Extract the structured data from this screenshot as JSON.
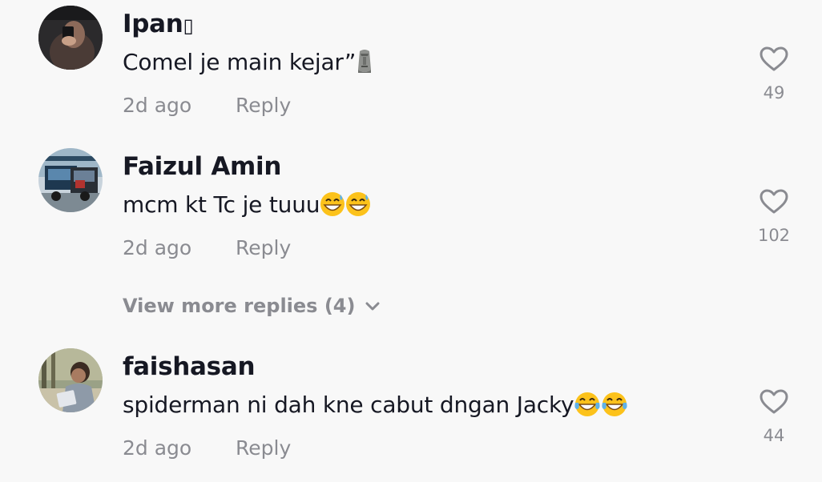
{
  "comments": [
    {
      "username": "Ipan",
      "username_suffix": "▯",
      "text": "Comel je main kejar”",
      "emoji": "moai-emoji",
      "time": "2d ago",
      "reply_label": "Reply",
      "likes": "49"
    },
    {
      "username": "Faizul Amin",
      "text": "mcm kt Tc je tuuu",
      "emoji": "grinning-sweat-emoji x2",
      "time": "2d ago",
      "reply_label": "Reply",
      "likes": "102"
    },
    {
      "username": "faishasan",
      "text": "spiderman ni dah kne cabut dngan Jacky",
      "emoji": "tears-of-joy-emoji x2",
      "time": "2d ago",
      "reply_label": "Reply",
      "likes": "44"
    }
  ],
  "view_more": {
    "label": "View more replies (4)",
    "icon": "chevron-down-icon"
  },
  "colors": {
    "background": "#f8f8f8",
    "primary_text": "#161823",
    "secondary_text": "#8a8b91",
    "heart_outline": "#8a8b91"
  }
}
